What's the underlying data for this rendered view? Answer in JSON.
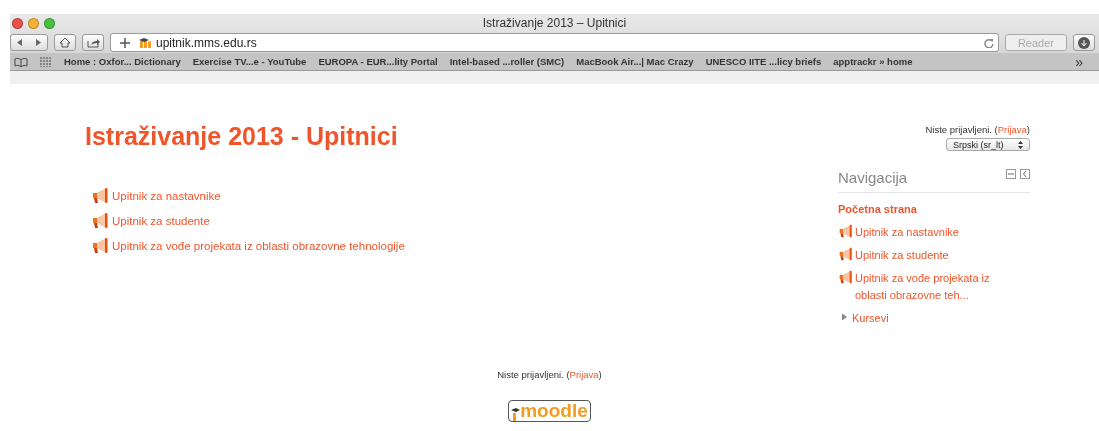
{
  "window": {
    "title": "Istraživanje 2013 – Upitnici"
  },
  "toolbar": {
    "address": "upitnik.mms.edu.rs",
    "reader": "Reader"
  },
  "bookmarks": [
    "Home : Oxfor... Dictionary",
    "Exercise TV...e - YouTube",
    "EUROPA - EUR...lity Portal",
    "Intel-based ...roller (SMC)",
    "MacBook Air...| Mac Crazy",
    "UNESCO IITE ...licy briefs",
    "apptrackr » home"
  ],
  "bookmarks_more": "»",
  "page": {
    "title": "Istraživanje 2013 - Upitnici",
    "login": {
      "text": "Niste prijavljeni. (",
      "link": "Prijava",
      "end": ")"
    },
    "language": "Srpski (sr_lt)",
    "activities": [
      "Upitnik za nastavnike",
      "Upitnik za studente",
      "Upitnik za vođe projekata iz oblasti obrazovne tehnologije"
    ]
  },
  "navigation": {
    "title": "Navigacija",
    "items": [
      {
        "kind": "home",
        "label": "Početna strana"
      },
      {
        "kind": "activity",
        "label": "Upitnik za nastavnike"
      },
      {
        "kind": "activity",
        "label": "Upitnik za studente"
      },
      {
        "kind": "activity",
        "label": "Upitnik za vođe projekata iz oblasti obrazovne teh..."
      },
      {
        "kind": "branch",
        "label": "Kursevi",
        "expanded": false
      }
    ]
  },
  "footer": {
    "login": {
      "text": "Niste prijavljeni. (",
      "link": "Prijava",
      "end": ")"
    },
    "logo": "moodle"
  }
}
